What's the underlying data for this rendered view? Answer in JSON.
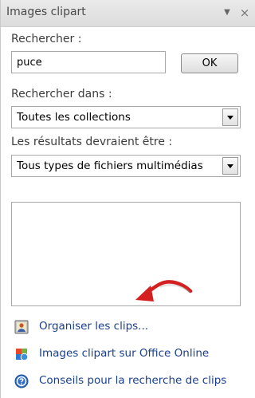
{
  "titlebar": {
    "title": "Images clipart",
    "menu_glyph": "▼",
    "close_glyph": "×"
  },
  "search": {
    "label": "Rechercher :",
    "value": "puce",
    "ok_label": "OK"
  },
  "search_in": {
    "label": "Rechercher dans :",
    "selected": "Toutes les collections"
  },
  "results_type": {
    "label": "Les résultats devraient être :",
    "selected": "Tous types de fichiers multimédias"
  },
  "links": [
    {
      "label": "Organiser les clips...",
      "icon": "organizer-icon"
    },
    {
      "label": "Images clipart sur Office Online",
      "icon": "office-online-icon"
    },
    {
      "label": "Conseils pour la recherche de clips",
      "icon": "help-icon"
    }
  ],
  "colors": {
    "link": "#1a3f8f",
    "arrow": "#d42020"
  }
}
